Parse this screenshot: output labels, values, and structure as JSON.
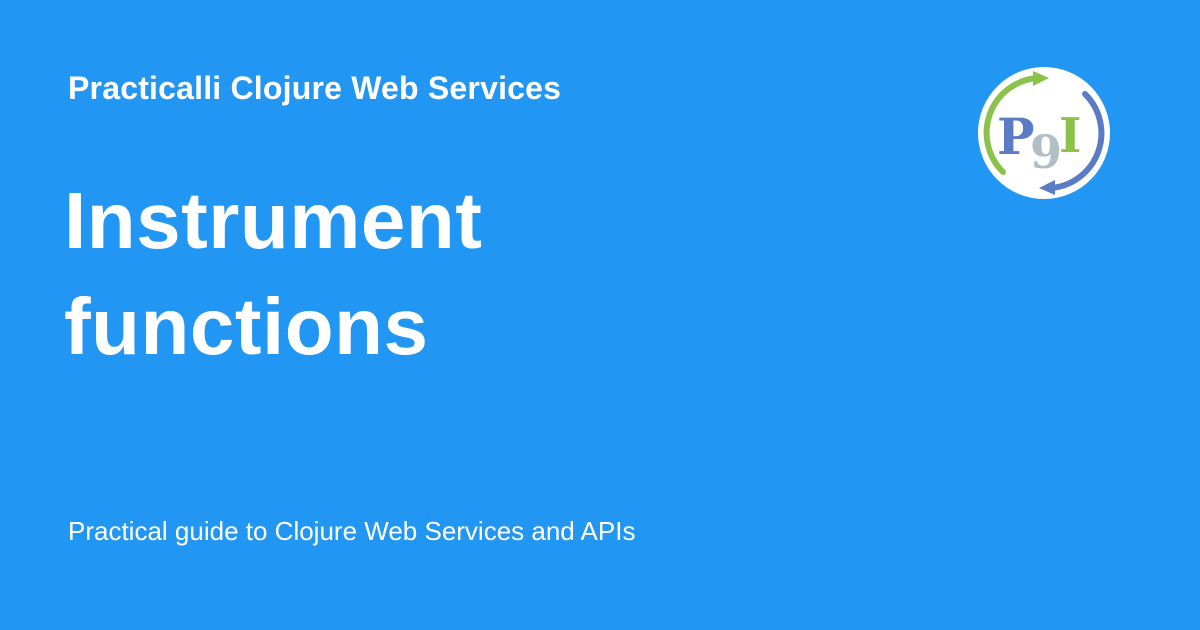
{
  "header": {
    "site_name": "Practicalli Clojure Web Services"
  },
  "main": {
    "title_line_1": "Instrument",
    "title_line_2": "functions",
    "description": "Practical guide to Clojure Web Services and APIs"
  },
  "logo": {
    "icon": "practicalli-logo-icon",
    "letters": [
      "P",
      "9",
      "I"
    ]
  },
  "colors": {
    "background": "#2196f3",
    "text": "#ffffff",
    "logo_blue": "#5b7bc4",
    "logo_green": "#8bc34a",
    "logo_grey": "#b0bec5"
  }
}
